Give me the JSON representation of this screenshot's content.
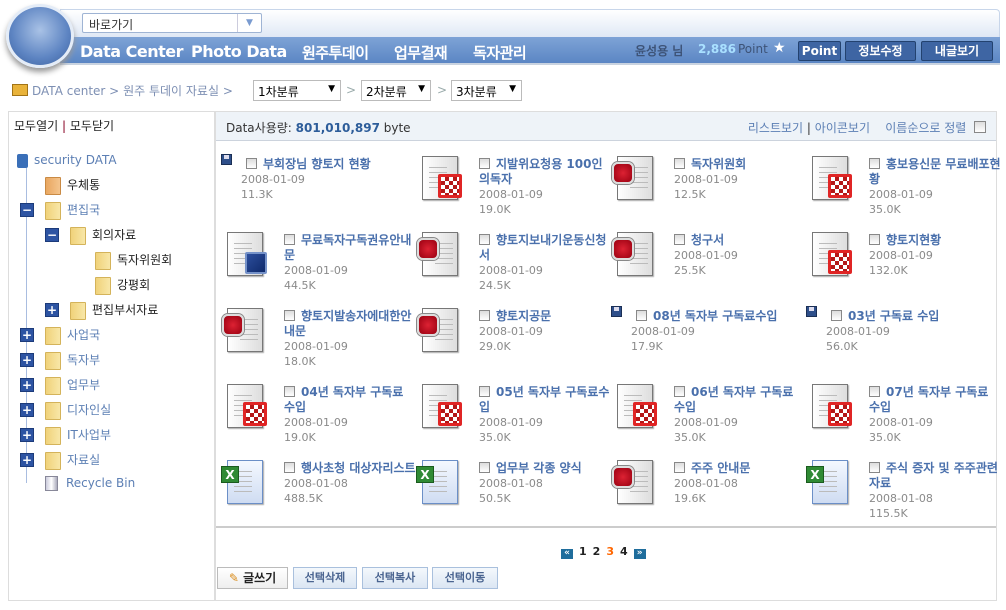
{
  "header": {
    "goto_placeholder": "바로가기",
    "nav": [
      "Data Center",
      "Photo Data",
      "원주투데이",
      "업무결재",
      "독자관리"
    ],
    "user_name": "윤성용 님",
    "points": "2,886",
    "points_label": "Point",
    "star": "★",
    "buttons": [
      "Point",
      "정보수정",
      "내글보기"
    ]
  },
  "breadcrumb": {
    "items": [
      "DATA center",
      "원주 투데이 자료실"
    ],
    "sep": ">",
    "selects": [
      "1차분류",
      "2차분류",
      "3차분류"
    ]
  },
  "tree": {
    "expand_all": "모두열기",
    "collapse_all": "모두닫기",
    "divider": "|",
    "root": "security DATA",
    "nodes": [
      {
        "label": "우체통",
        "level": 1,
        "toggle": "",
        "color": "orange"
      },
      {
        "label": "편집국",
        "level": 1,
        "toggle": "−"
      },
      {
        "label": "회의자료",
        "level": 2,
        "toggle": "−"
      },
      {
        "label": "독자위원회",
        "level": 3,
        "toggle": ""
      },
      {
        "label": "강평회",
        "level": 3,
        "toggle": ""
      },
      {
        "label": "편집부서자료",
        "level": 2,
        "toggle": "+"
      },
      {
        "label": "사업국",
        "level": 1,
        "toggle": "+"
      },
      {
        "label": "독자부",
        "level": 1,
        "toggle": "+"
      },
      {
        "label": "업무부",
        "level": 1,
        "toggle": "+"
      },
      {
        "label": "디자인실",
        "level": 1,
        "toggle": "+"
      },
      {
        "label": "IT사업부",
        "level": 1,
        "toggle": "+"
      },
      {
        "label": "자료실",
        "level": 1,
        "toggle": "+"
      }
    ],
    "recycle": "Recycle Bin"
  },
  "main": {
    "usage_label": "Data사용량:",
    "usage_value": "801,010,897",
    "usage_unit": "byte",
    "list_view": "리스트보기",
    "icon_view": "아이콘보기",
    "sort": "이름순으로 정렬",
    "files": [
      {
        "type": "floppy",
        "title": "부회장님 향토지 현황",
        "date": "2008-01-09",
        "size": "11.3K"
      },
      {
        "type": "ppt",
        "title": "지발위요청용 100인의독자",
        "date": "2008-01-09",
        "size": "19.0K"
      },
      {
        "type": "hwp",
        "title": "독자위원회",
        "date": "2008-01-09",
        "size": "12.5K"
      },
      {
        "type": "ppt",
        "title": "홍보용신문 무료배포현황",
        "date": "2008-01-09",
        "size": "35.0K"
      },
      {
        "type": "doc",
        "title": "무료독자구독권유안내문",
        "date": "2008-01-09",
        "size": "44.5K"
      },
      {
        "type": "hwp",
        "title": "향토지보내기운동신청서",
        "date": "2008-01-09",
        "size": "24.5K"
      },
      {
        "type": "hwp",
        "title": "청구서",
        "date": "2008-01-09",
        "size": "25.5K"
      },
      {
        "type": "ppt",
        "title": "향토지현황",
        "date": "2008-01-09",
        "size": "132.0K"
      },
      {
        "type": "hwp",
        "title": "향토지발송자에대한안내문",
        "date": "2008-01-09",
        "size": "18.0K"
      },
      {
        "type": "hwp",
        "title": "향토지공문",
        "date": "2008-01-09",
        "size": "29.0K"
      },
      {
        "type": "floppy",
        "title": "08년 독자부 구독료수입",
        "date": "2008-01-09",
        "size": "17.9K"
      },
      {
        "type": "floppy",
        "title": "03년 구독료 수입",
        "date": "2008-01-09",
        "size": "56.0K"
      },
      {
        "type": "ppt",
        "title": "04년 독자부 구독료 수입",
        "date": "2008-01-09",
        "size": "19.0K"
      },
      {
        "type": "ppt",
        "title": "05년 독자부 구독료수입",
        "date": "2008-01-09",
        "size": "35.0K"
      },
      {
        "type": "ppt",
        "title": "06년 독자부 구독료 수입",
        "date": "2008-01-09",
        "size": "35.0K"
      },
      {
        "type": "ppt",
        "title": "07년 독자부 구독료 수입",
        "date": "2008-01-09",
        "size": "35.0K"
      },
      {
        "type": "xls",
        "title": "행사초청 대상자리스트",
        "date": "2008-01-08",
        "size": "488.5K"
      },
      {
        "type": "xls",
        "title": "업무부 각종 양식",
        "date": "2008-01-08",
        "size": "50.5K"
      },
      {
        "type": "hwp",
        "title": "주주 안내문",
        "date": "2008-01-08",
        "size": "19.6K"
      },
      {
        "type": "xls",
        "title": "주식 증자 및 주주관련 자료",
        "date": "2008-01-08",
        "size": "115.5K"
      }
    ],
    "pagination": {
      "pages": [
        "1",
        "2",
        "3",
        "4"
      ],
      "current": "3",
      "prev": "«",
      "next": "»"
    },
    "actions": {
      "write": "글쓰기",
      "delete": "선택삭제",
      "copy": "선택복사",
      "move": "선택이동"
    }
  },
  "colors": {
    "accent": "#4a70ac",
    "nav": "#5b86c4",
    "current_page": "#ff6600"
  }
}
